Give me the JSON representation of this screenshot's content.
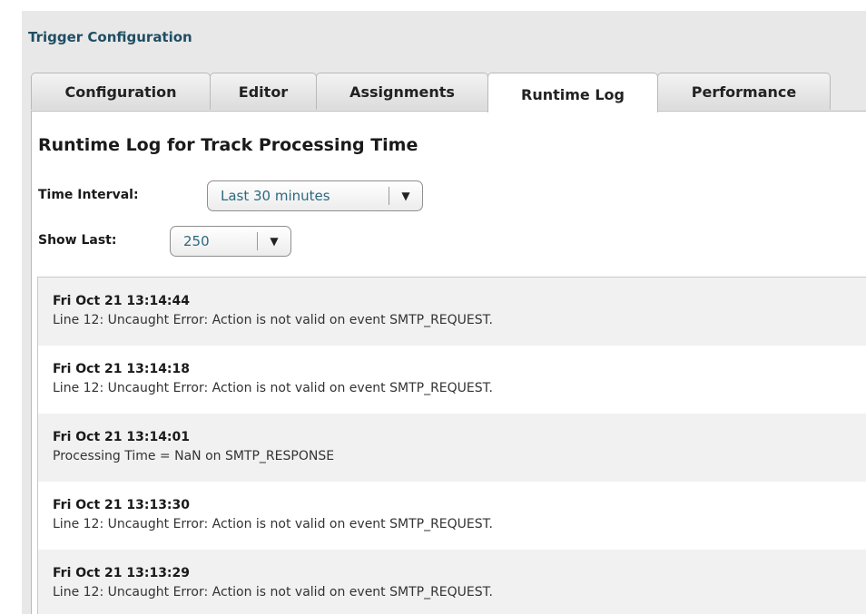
{
  "panel": {
    "title": "Trigger Configuration"
  },
  "tabs": [
    {
      "label": "Configuration",
      "active": false
    },
    {
      "label": "Editor",
      "active": false
    },
    {
      "label": "Assignments",
      "active": false
    },
    {
      "label": "Runtime Log",
      "active": true
    },
    {
      "label": "Performance",
      "active": false
    }
  ],
  "runtime_log": {
    "heading": "Runtime Log for Track Processing Time",
    "time_interval": {
      "label": "Time Interval:",
      "value": "Last 30 minutes",
      "arrow_icon": "triangle-down-icon"
    },
    "show_last": {
      "label": "Show Last:",
      "value": "250",
      "arrow_icon": "triangle-down-icon"
    },
    "entries": [
      {
        "timestamp": "Fri Oct 21 13:14:44",
        "message": "Line 12: Uncaught Error: Action is not valid on event SMTP_REQUEST."
      },
      {
        "timestamp": "Fri Oct 21 13:14:18",
        "message": "Line 12: Uncaught Error: Action is not valid on event SMTP_REQUEST."
      },
      {
        "timestamp": "Fri Oct 21 13:14:01",
        "message": "Processing Time = NaN on SMTP_RESPONSE"
      },
      {
        "timestamp": "Fri Oct 21 13:13:30",
        "message": "Line 12: Uncaught Error: Action is not valid on event SMTP_REQUEST."
      },
      {
        "timestamp": "Fri Oct 21 13:13:29",
        "message": "Line 12: Uncaught Error: Action is not valid on event SMTP_REQUEST."
      }
    ]
  },
  "colors": {
    "panel_title": "#1f4e63",
    "select_text": "#2c6a80",
    "panel_bg": "#e8e8e8",
    "log_row_alt": "#f1f1f1"
  }
}
